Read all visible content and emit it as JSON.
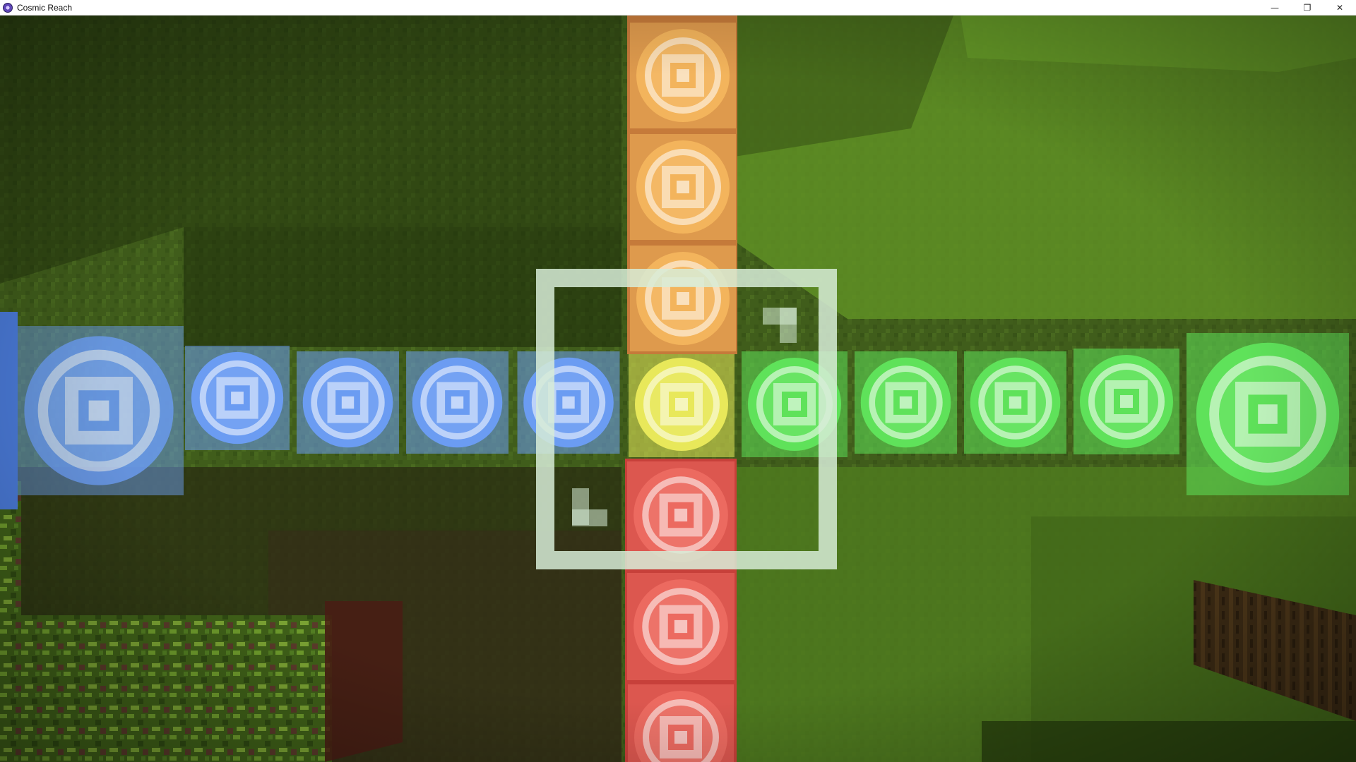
{
  "window": {
    "title": "Cosmic Reach",
    "icon": "cosmic-reach-app-icon",
    "controls": [
      {
        "name": "minimize-button",
        "icon": "minimize-icon",
        "glyph": "—"
      },
      {
        "name": "restore-button",
        "icon": "restore-icon",
        "glyph": "❐"
      },
      {
        "name": "close-button",
        "icon": "close-icon",
        "glyph": "✕"
      }
    ]
  },
  "game": {
    "scene": "underground cave with grass walls and colored light blocks",
    "colors": {
      "grass_dark": "#3d5519",
      "grass_light": "#6b9a2a",
      "block_orange": "#f6c27a",
      "block_yellow": "#f4f078",
      "block_red": "#f08277",
      "block_blue": "#7fa5f5",
      "block_green": "#7af26f",
      "selection_outline": "#d9efd9"
    }
  }
}
